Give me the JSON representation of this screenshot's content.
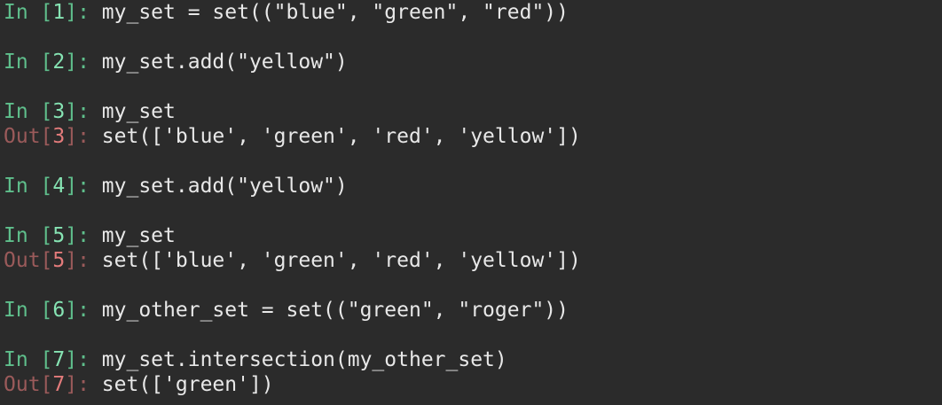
{
  "session": [
    {
      "in_label": "In [",
      "in_num": "1",
      "in_close": "]: ",
      "code": "my_set = set((\"blue\", \"green\", \"red\"))"
    },
    {
      "in_label": "In [",
      "in_num": "2",
      "in_close": "]: ",
      "code": "my_set.add(\"yellow\")"
    },
    {
      "in_label": "In [",
      "in_num": "3",
      "in_close": "]: ",
      "code": "my_set",
      "out_label": "Out[",
      "out_num": "3",
      "out_close": "]: ",
      "output": "set(['blue', 'green', 'red', 'yellow'])"
    },
    {
      "in_label": "In [",
      "in_num": "4",
      "in_close": "]: ",
      "code": "my_set.add(\"yellow\")"
    },
    {
      "in_label": "In [",
      "in_num": "5",
      "in_close": "]: ",
      "code": "my_set",
      "out_label": "Out[",
      "out_num": "5",
      "out_close": "]: ",
      "output": "set(['blue', 'green', 'red', 'yellow'])"
    },
    {
      "in_label": "In [",
      "in_num": "6",
      "in_close": "]: ",
      "code": "my_other_set = set((\"green\", \"roger\"))"
    },
    {
      "in_label": "In [",
      "in_num": "7",
      "in_close": "]: ",
      "code": "my_set.intersection(my_other_set)",
      "out_label": "Out[",
      "out_num": "7",
      "out_close": "]: ",
      "output": "set(['green'])"
    }
  ],
  "colors": {
    "background": "#2b2b2b",
    "in_prompt": "#5fbf8c",
    "in_number": "#86e3b3",
    "out_prompt": "#9a5a5a",
    "out_number": "#e37b7b",
    "text": "#e8e8e8"
  }
}
